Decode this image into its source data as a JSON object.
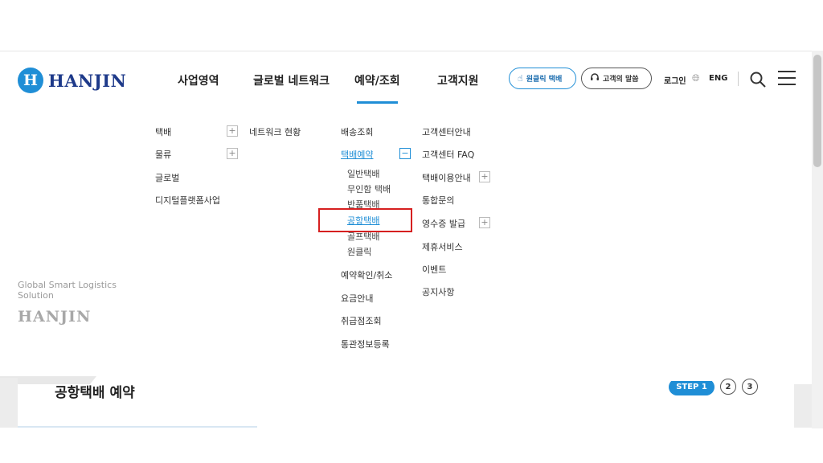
{
  "header": {
    "logo_mark": "H",
    "logo_text": "HANJIN",
    "nav": [
      "사업영역",
      "글로벌 네트워크",
      "예약/조회",
      "고객지원"
    ],
    "active_nav": "예약/조회",
    "quick_buttons": [
      {
        "label": "원클릭 택배",
        "icon": "touch-icon"
      },
      {
        "label": "고객의 말씀",
        "icon": "headset-icon"
      }
    ],
    "login": "로그인",
    "language": "ENG"
  },
  "mega_menu": {
    "business": [
      "택배",
      "물류",
      "글로벌",
      "디지털플랫폼사업"
    ],
    "global": [
      "네트워크 현황"
    ],
    "reservation": {
      "items": [
        "배송조회",
        "택배예약",
        "예약확인/취소",
        "요금안내",
        "취급점조회",
        "통관정보등록"
      ],
      "expanded": "택배예약",
      "sub_items": [
        "일반택배",
        "무인함 택배",
        "반품택배",
        "공항택배",
        "골프택배",
        "원클릭"
      ],
      "highlighted": "공항택배"
    },
    "support": [
      "고객센터안내",
      "고객센터 FAQ",
      "택배이용안내",
      "통합문의",
      "영수증 발급",
      "제휴서비스",
      "이벤트",
      "공지사항"
    ],
    "toggle_plus": "+",
    "toggle_minus": "−"
  },
  "side": {
    "slogan_line1": "Global Smart Logistics",
    "slogan_line2": "Solution",
    "logo": "HANJIN"
  },
  "page": {
    "title": "공항택배 예약",
    "steps": [
      "STEP 1",
      "2",
      "3"
    ]
  },
  "colors": {
    "accent": "#1f8ed6",
    "brand_navy": "#1e3a8a",
    "highlight_red": "#d62020"
  }
}
